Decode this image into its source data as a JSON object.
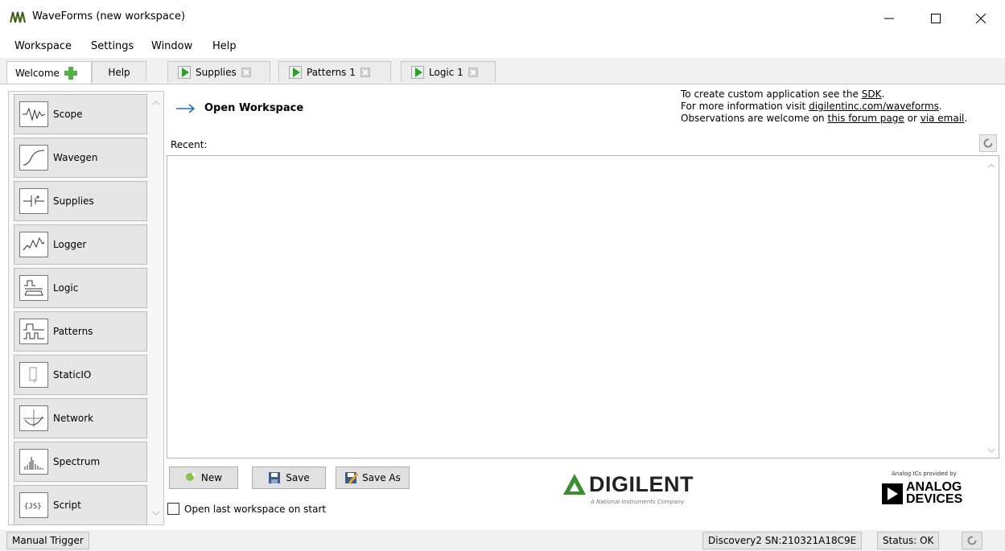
{
  "window": {
    "title": "WaveForms  (new workspace)"
  },
  "menu": [
    "Workspace",
    "Settings",
    "Window",
    "Help"
  ],
  "tabs": {
    "welcome": "Welcome",
    "help": "Help",
    "supplies": "Supplies",
    "patterns": "Patterns 1",
    "logic": "Logic 1"
  },
  "instruments": [
    "Scope",
    "Wavegen",
    "Supplies",
    "Logger",
    "Logic",
    "Patterns",
    "StaticIO",
    "Network",
    "Spectrum",
    "Script"
  ],
  "welcome": {
    "open_workspace": "Open Workspace",
    "info_line1_pre": "To create custom application see the ",
    "info_line1_link": "SDK",
    "info_line1_post": ".",
    "info_line2_pre": "For more information visit ",
    "info_line2_link": "digilentinc.com/waveforms",
    "info_line2_post": ".",
    "info_line3_pre": "Observations are welcome on ",
    "info_line3_link1": "this forum page",
    "info_line3_mid": " or ",
    "info_line3_link2": "via email",
    "info_line3_post": ".",
    "recent_label": "Recent:",
    "buttons": {
      "new": "New",
      "save": "Save",
      "save_as": "Save As"
    },
    "checkbox_label": "Open last workspace on start",
    "digilent_logo": "DIGILENT",
    "digilent_tagline": "A National Instruments Company",
    "adi_caption": "Analog ICs provided by",
    "adi_line1": "ANALOG",
    "adi_line2": "DEVICES"
  },
  "status": {
    "trigger": "Manual Trigger",
    "device": "Discovery2 SN:210321A18C9E",
    "state": "Status: OK"
  }
}
